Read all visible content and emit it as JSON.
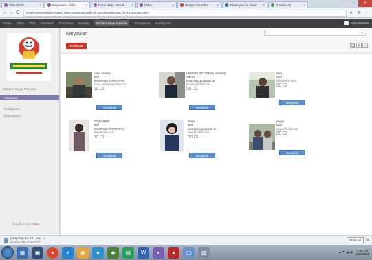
{
  "browser": {
    "tabs": [
      {
        "title": "Odoo POS",
        "active": false
      },
      {
        "title": "Karyawan - Odoo",
        "active": true
      },
      {
        "title": "Odoo Help - Forum",
        "active": false
      },
      {
        "title": "Odoo",
        "active": false
      },
      {
        "title": "Belajar Odoo/Tut",
        "active": false
      },
      {
        "title": "Thank you for down",
        "active": false
      },
      {
        "title": "Downloads",
        "active": false
      }
    ],
    "url": "localhost:8069/web?#view_type=kanban&model=hr.employee&menu_id=124&action=427",
    "back": "←",
    "forward": "→",
    "reload": "C",
    "addr_icons": "★ ⚙ ⋮"
  },
  "appnav": {
    "items": [
      "Pesan",
      "Sales",
      "POS",
      "Akuntansi",
      "Purchases",
      "Gudang",
      "Sumber Daya Manusia",
      "Pengaturan",
      "Konfigurasi"
    ],
    "active_index": 6,
    "user": "Administrator"
  },
  "sidebar": {
    "section": "Sumber Daya Manusia",
    "items": [
      "Karyawan",
      "Konfigurasi",
      "Departemen"
    ],
    "active_index": 0,
    "powered_prefix": "Disajikan oleh",
    "powered_brand": "Odoo"
  },
  "main": {
    "title": "Karyawan",
    "create_label": "Membuat",
    "search_placeholder": "",
    "search_icon": "search-icon",
    "filter_icon": "▾",
    "view_kanban": "▦",
    "view_list": "▤",
    "view_other": "▢"
  },
  "employees": [
    {
      "name": "hairul anwani",
      "role": "staff",
      "dept": "MAMPANG PRAPATAN",
      "email": "hairul_anwani@ofrik.com",
      "tags": [
        "✉",
        "1"
      ],
      "follow": "Mengikuti"
    },
    {
      "name": "HENDRA SETIAWAN (arberta)",
      "role": "Admin",
      "dept": "mampang prapatan XI",
      "email": "hendra@ofrik.com",
      "tags": [
        "✉",
        "1"
      ],
      "follow": "Mengikuti"
    },
    {
      "name": "icha",
      "role": "staff",
      "dept": "",
      "email": "icha@ofrik.com",
      "tags": [
        "✉",
        "1"
      ],
      "follow": "Mengikuti"
    },
    {
      "name": "POHANDINI",
      "role": "staff",
      "dept": "MAMPANG PRAPATAN",
      "email": "dhini@ofrik.com",
      "tags": [
        "✉",
        "1"
      ],
      "follow": "Mengikuti"
    },
    {
      "name": "triana",
      "role": "staff",
      "dept": "mampang prapatan XI",
      "email": "triana@ofrik.com",
      "tags": [
        "✉",
        "1"
      ],
      "follow": "Mengikuti"
    },
    {
      "name": "yayan",
      "role": "staff",
      "dept": "",
      "email": "yayan@ofrik.com",
      "tags": [
        "✉",
        "1"
      ],
      "follow": "Mengikuti"
    }
  ],
  "downloads": {
    "file_name": "postgresql-9.6.8-1...exe",
    "file_detail": "22.8/29 MB, 2 mins left",
    "chevron": "^",
    "show_all": "Show all",
    "close": "X"
  },
  "taskbar": {
    "tray_text": "▲ ⚑ ◢ ◀)",
    "time": "1:35 AM",
    "date": "5/22/2018"
  },
  "colors": {
    "accent": "#7c7bad",
    "create": "#c0392b",
    "follow": "#5c8ec9",
    "topnav": "#414141"
  }
}
